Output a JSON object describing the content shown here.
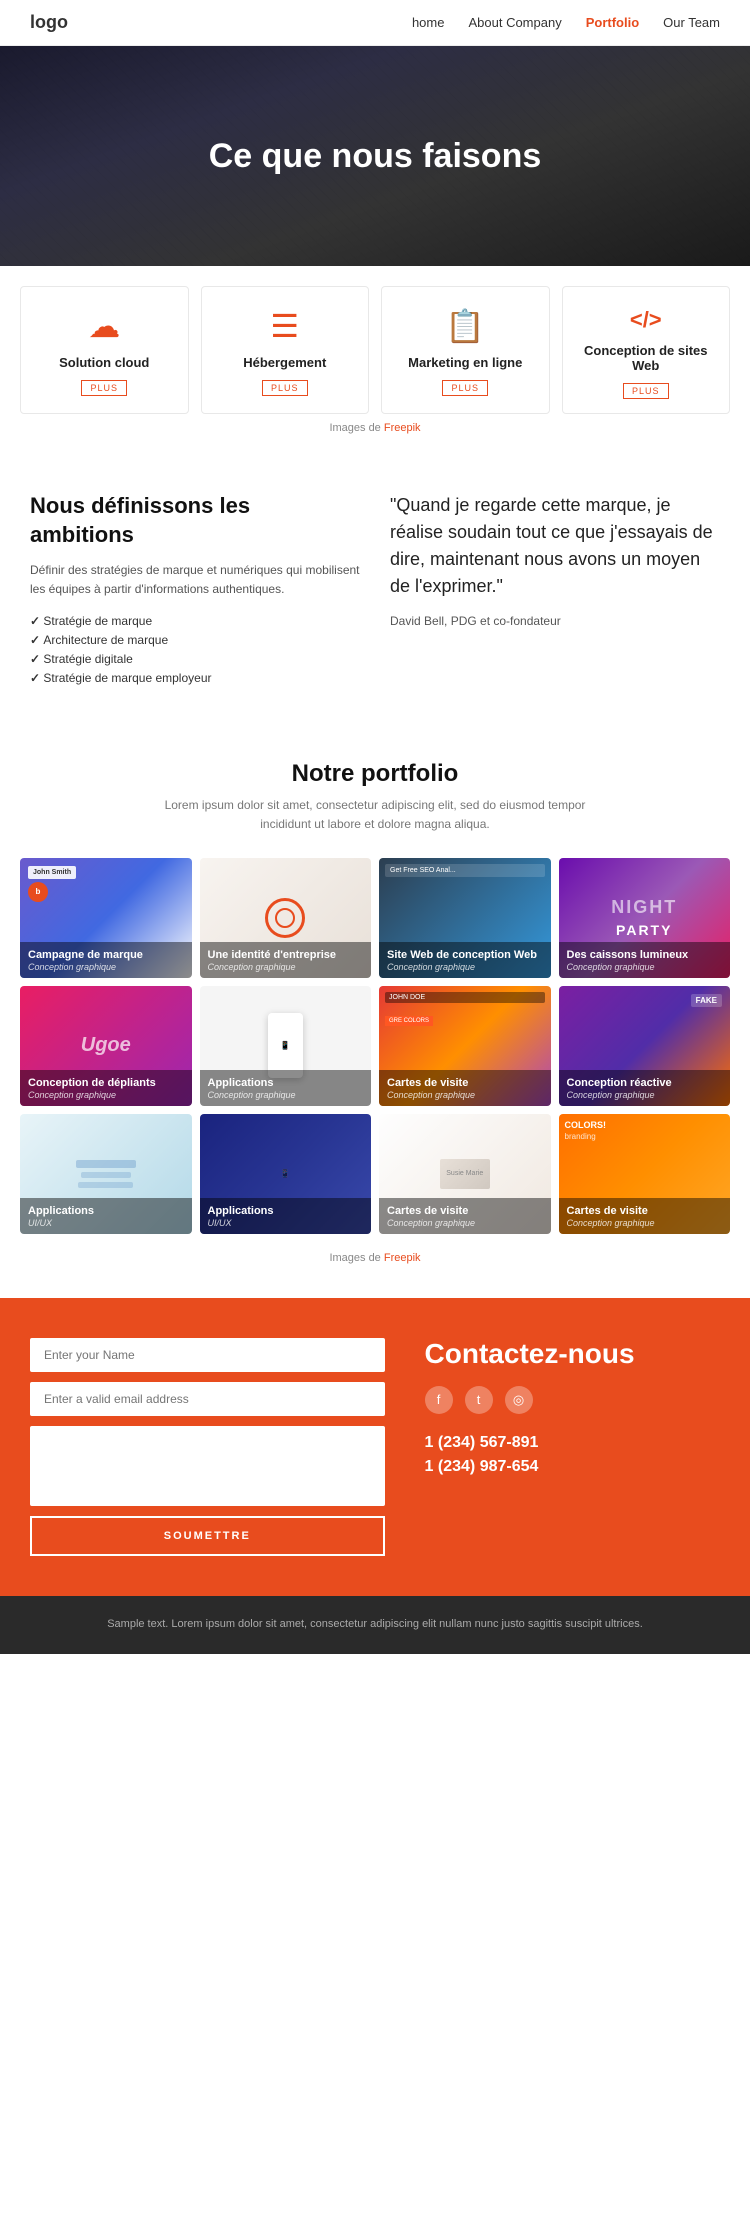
{
  "nav": {
    "logo": "logo",
    "links": [
      {
        "label": "home",
        "active": false
      },
      {
        "label": "About Company",
        "active": false
      },
      {
        "label": "Portfolio",
        "active": true
      },
      {
        "label": "Our Team",
        "active": false
      }
    ]
  },
  "hero": {
    "title": "Ce que nous faisons"
  },
  "services": {
    "items": [
      {
        "icon": "☁",
        "title": "Solution cloud",
        "plus": "PLUS"
      },
      {
        "icon": "≡",
        "title": "Hébergement",
        "plus": "PLUS"
      },
      {
        "icon": "📋",
        "title": "Marketing en ligne",
        "plus": "PLUS"
      },
      {
        "icon": "</>",
        "title": "Conception de sites Web",
        "plus": "PLUS"
      }
    ],
    "credit_prefix": "Images de ",
    "credit_link": "Freepik"
  },
  "about": {
    "title": "Nous définissons les ambitions",
    "description": "Définir des stratégies de marque et numériques qui mobilisent les équipes à partir d'informations authentiques.",
    "list": [
      "Stratégie de marque",
      "Architecture de marque",
      "Stratégie digitale",
      "Stratégie de marque employeur"
    ],
    "quote": "\"Quand je regarde cette marque, je réalise soudain tout ce que j'essayais de dire, maintenant nous avons un moyen de l'exprimer.\"",
    "author": "David Bell, PDG et co-fondateur"
  },
  "portfolio": {
    "title": "Notre portfolio",
    "subtitle": "Lorem ipsum dolor sit amet, consectetur adipiscing elit, sed do eiusmod tempor\nincididunt ut labore et dolore magna aliqua.",
    "items": [
      {
        "title": "Campagne de marque",
        "subtitle": "Conception graphique",
        "bg": "p1"
      },
      {
        "title": "Une identité d'entreprise",
        "subtitle": "Conception graphique",
        "bg": "p2"
      },
      {
        "title": "Site Web de conception Web",
        "subtitle": "Conception graphique",
        "bg": "p3"
      },
      {
        "title": "Des caissons lumineux",
        "subtitle": "Conception graphique",
        "bg": "p4"
      },
      {
        "title": "Conception de dépliants",
        "subtitle": "Conception graphique",
        "bg": "p5"
      },
      {
        "title": "Applications",
        "subtitle": "Conception graphique",
        "bg": "p6"
      },
      {
        "title": "Cartes de visite",
        "subtitle": "Conception graphique",
        "bg": "p7"
      },
      {
        "title": "Conception réactive",
        "subtitle": "Conception graphique",
        "bg": "p8"
      },
      {
        "title": "Applications",
        "subtitle": "UI/UX",
        "bg": "p9"
      },
      {
        "title": "Applications",
        "subtitle": "UI/UX",
        "bg": "p10"
      },
      {
        "title": "Cartes de visite",
        "subtitle": "Conception graphique",
        "bg": "p11"
      },
      {
        "title": "Cartes de visite",
        "subtitle": "Conception graphique",
        "bg": "p12"
      }
    ],
    "credit_prefix": "Images de ",
    "credit_link": "Freepik"
  },
  "contact": {
    "title": "Contactez-nous",
    "form": {
      "name_placeholder": "Enter your Name",
      "email_placeholder": "Enter a valid email address",
      "message_placeholder": "",
      "submit_label": "SOUMETTRE"
    },
    "phones": [
      "1 (234) 567-891",
      "1 (234) 987-654"
    ],
    "social": [
      "f",
      "t",
      "i"
    ]
  },
  "footer": {
    "text": "Sample text. Lorem ipsum dolor sit amet, consectetur adipiscing elit nullam nunc justo sagittis suscipit ultrices."
  }
}
